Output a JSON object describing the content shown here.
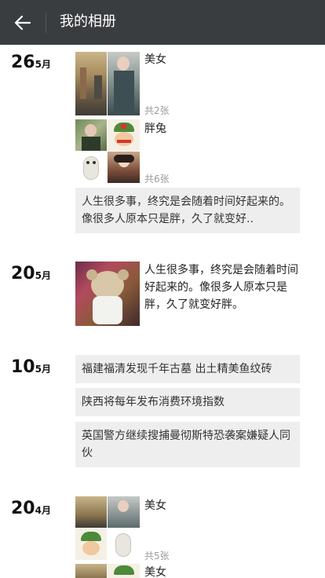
{
  "header": {
    "title": "我的相册",
    "back_icon": "arrow-left-icon"
  },
  "entries": [
    {
      "day": "26",
      "month": "5月",
      "albums": [
        {
          "label": "美女",
          "count": "共2张"
        },
        {
          "label": "胖兔",
          "count": "共6张"
        }
      ],
      "text": "人生很多事，终究是会随着时间好起来的。像很多人原本只是胖，久了就变好.."
    },
    {
      "day": "20",
      "month": "5月",
      "post_text": "人生很多事，终究是会随着时间好起来的。像很多人原本只是胖，久了就变好胖。"
    },
    {
      "day": "10",
      "month": "5月",
      "news": [
        "福建福清发现千年古墓 出土精美鱼纹砖",
        "陕西将每年发布消费环境指数",
        "英国警方继续搜捕曼彻斯特恐袭案嫌疑人同伙"
      ]
    },
    {
      "day": "20",
      "month": "4月",
      "albums": [
        {
          "label": "美女",
          "count": "共5张"
        },
        {
          "label": "美女"
        }
      ]
    }
  ]
}
